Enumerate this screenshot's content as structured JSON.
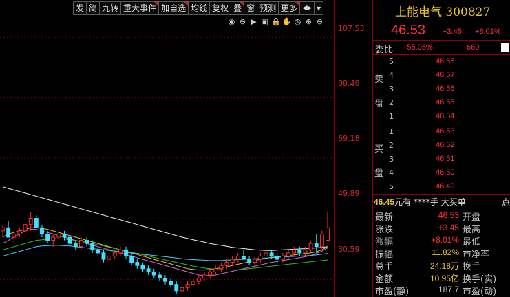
{
  "toolbar": {
    "buttons": [
      "发",
      "简",
      "九转",
      "重大事件",
      "加自选",
      "均线",
      "复权",
      "叠",
      "窗",
      "预测",
      "更多"
    ],
    "nav": "◀▶"
  },
  "tools": [
    "eye-icon",
    "zoom-out-icon",
    "play-icon",
    "chart-toggle-icon",
    "lock-icon",
    "hand-icon",
    "clock-icon",
    "plus-icon",
    "minus-icon"
  ],
  "price_axis": {
    "ticks": [
      "107.53",
      "88.48",
      "69.18",
      "49.89",
      "30.59"
    ]
  },
  "stock": {
    "name": "上能电气",
    "code": "300827",
    "price": "46.53",
    "change": "+3.45",
    "change_pct": "+8.01%"
  },
  "weibi": {
    "label": "委比",
    "value": "+55.05%",
    "diff": "660"
  },
  "sell": {
    "label_top": "卖",
    "label_bottom": "盘",
    "levels": [
      "5",
      "4",
      "3",
      "2",
      "1"
    ],
    "prices": [
      "46.58",
      "46.57",
      "46.56",
      "46.55",
      "46.54"
    ]
  },
  "buy": {
    "label_top": "买",
    "label_bottom": "盘",
    "levels": [
      "1",
      "2",
      "3",
      "4",
      "5"
    ],
    "prices": [
      "46.53",
      "46.52",
      "46.51",
      "46.50",
      "46.49"
    ]
  },
  "trade": {
    "price": "46.45",
    "unit": "元有",
    "vol": "****手",
    "type": "大买单",
    "extra": "点"
  },
  "stats": [
    {
      "l": "最新",
      "v": "46.53",
      "r": "开盘",
      "color": "#ff3030"
    },
    {
      "l": "涨跌",
      "v": "+3.45",
      "r": "最高",
      "color": "#ff3030"
    },
    {
      "l": "涨幅",
      "v": "+8.01%",
      "r": "最低",
      "color": "#ff3030"
    },
    {
      "l": "振幅",
      "v": "11.82%",
      "r": "市净率",
      "color": "#e6c229"
    },
    {
      "l": "总手",
      "v": "24.18万",
      "r": "换手",
      "color": "#e6c229"
    },
    {
      "l": "金额",
      "v": "10.95亿",
      "r": "换手(实)",
      "color": "#e6c229"
    },
    {
      "l": "市盈(静)",
      "v": "187.7",
      "r": "市盈(动)",
      "color": "#c0c0c0"
    }
  ],
  "chart_data": {
    "type": "candlestick",
    "ylim": [
      25,
      115
    ],
    "candles": [
      [
        46,
        48,
        44,
        47
      ],
      [
        47,
        49,
        45,
        44
      ],
      [
        44,
        46,
        42,
        45
      ],
      [
        45,
        47,
        44,
        46
      ],
      [
        46,
        49,
        45,
        48
      ],
      [
        48,
        52,
        46,
        50
      ],
      [
        50,
        51,
        47,
        47
      ],
      [
        47,
        48,
        44,
        45
      ],
      [
        45,
        46,
        42,
        43
      ],
      [
        43,
        45,
        41,
        44
      ],
      [
        44,
        46,
        43,
        45
      ],
      [
        45,
        46,
        43,
        44
      ],
      [
        44,
        45,
        41,
        42
      ],
      [
        42,
        43,
        40,
        41
      ],
      [
        41,
        44,
        40,
        43
      ],
      [
        43,
        44,
        41,
        42
      ],
      [
        42,
        43,
        39,
        40
      ],
      [
        40,
        41,
        38,
        39
      ],
      [
        39,
        40,
        36,
        37
      ],
      [
        37,
        39,
        36,
        38
      ],
      [
        38,
        40,
        37,
        39
      ],
      [
        39,
        41,
        38,
        40
      ],
      [
        40,
        41,
        37,
        38
      ],
      [
        38,
        39,
        35,
        36
      ],
      [
        36,
        37,
        34,
        35
      ],
      [
        35,
        36,
        33,
        34
      ],
      [
        34,
        35,
        32,
        33
      ],
      [
        33,
        34,
        31,
        32
      ],
      [
        32,
        33,
        30,
        31
      ],
      [
        31,
        32,
        29,
        30
      ],
      [
        30,
        31,
        28,
        29
      ],
      [
        29,
        30,
        26,
        27
      ],
      [
        27,
        29,
        26,
        28
      ],
      [
        28,
        30,
        27,
        29
      ],
      [
        29,
        31,
        28,
        30
      ],
      [
        30,
        32,
        29,
        31
      ],
      [
        31,
        33,
        30,
        32
      ],
      [
        32,
        34,
        31,
        33
      ],
      [
        33,
        35,
        32,
        34
      ],
      [
        34,
        36,
        33,
        35
      ],
      [
        35,
        37,
        34,
        36
      ],
      [
        36,
        38,
        35,
        37
      ],
      [
        37,
        39,
        36,
        38
      ],
      [
        38,
        40,
        37,
        37
      ],
      [
        37,
        38,
        35,
        36
      ],
      [
        36,
        38,
        35,
        37
      ],
      [
        37,
        39,
        36,
        38
      ],
      [
        38,
        40,
        37,
        39
      ],
      [
        39,
        40,
        37,
        38
      ],
      [
        38,
        39,
        36,
        37
      ],
      [
        37,
        39,
        36,
        38
      ],
      [
        38,
        40,
        37,
        39
      ],
      [
        39,
        41,
        38,
        40
      ],
      [
        40,
        41,
        38,
        39
      ],
      [
        39,
        41,
        38,
        40
      ],
      [
        40,
        43,
        39,
        42
      ],
      [
        42,
        45,
        39,
        41
      ],
      [
        41,
        46,
        40,
        45
      ],
      [
        43,
        52,
        43,
        47
      ]
    ],
    "ma": [
      {
        "color": "#f0f0f0",
        "values": [
          60,
          59.5,
          59,
          58.5,
          58,
          57.5,
          57,
          56.5,
          56,
          55.5,
          55,
          54.5,
          54,
          53.5,
          53,
          52.5,
          52,
          51.5,
          51,
          50.5,
          50,
          49.5,
          49,
          48.5,
          48,
          47.5,
          47,
          46.5,
          46,
          45.5,
          45,
          44.5,
          44,
          43.6,
          43.2,
          42.8,
          42.4,
          42,
          41.7,
          41.4,
          41.1,
          40.8,
          40.6,
          40.4,
          40.2,
          40,
          39.9,
          39.8,
          39.8,
          39.9,
          40,
          40.1,
          40.2,
          40.3,
          40.4,
          40.5,
          40.6,
          40.8,
          41
        ]
      },
      {
        "color": "#e6c229",
        "values": [
          44,
          45,
          45.5,
          46,
          46.5,
          47,
          47,
          46.8,
          46.5,
          46,
          45.5,
          45,
          44.5,
          44,
          43.5,
          43,
          42.5,
          42,
          41.5,
          41,
          40.5,
          40,
          39.5,
          39,
          38.5,
          38,
          37.5,
          37,
          36.5,
          36,
          35.5,
          35,
          34.5,
          34,
          33.8,
          33.6,
          33.6,
          33.8,
          34,
          34.3,
          34.6,
          35,
          35.4,
          35.8,
          36.2,
          36.6,
          37,
          37.3,
          37.6,
          37.8,
          38,
          38.2,
          38.4,
          38.6,
          38.8,
          39,
          39.4,
          40,
          41
        ]
      },
      {
        "color": "#e060e0",
        "values": [
          42,
          43,
          44,
          45,
          46,
          46.5,
          46.5,
          46,
          45.5,
          45,
          44.5,
          44,
          43.5,
          43,
          42.5,
          42,
          41.5,
          41,
          40.5,
          40,
          39.5,
          39,
          38.5,
          38,
          37.5,
          37,
          36.5,
          36,
          35.5,
          35,
          34.5,
          34,
          33.5,
          33,
          32.5,
          32,
          31.8,
          31.8,
          32,
          32.4,
          32.8,
          33.2,
          33.6,
          34,
          34.4,
          34.8,
          35.2,
          35.6,
          36,
          36.3,
          36.6,
          36.9,
          37.2,
          37.5,
          37.8,
          38.2,
          38.8,
          39.6,
          40.6
        ]
      },
      {
        "color": "#20c020",
        "values": [
          40,
          40.5,
          41,
          41.5,
          42,
          42.5,
          43,
          43.2,
          43.4,
          43.5,
          43.5,
          43.4,
          43.2,
          43,
          42.7,
          42.4,
          42,
          41.6,
          41.2,
          40.8,
          40.4,
          40,
          39.6,
          39.2,
          38.8,
          38.4,
          38,
          37.6,
          37.2,
          36.8,
          36.4,
          36,
          35.6,
          35.2,
          34.8,
          34.5,
          34.2,
          34,
          33.8,
          33.7,
          33.6,
          33.6,
          33.7,
          33.8,
          34,
          34.2,
          34.4,
          34.6,
          34.8,
          35,
          35.2,
          35.4,
          35.6,
          35.8,
          36,
          36.2,
          36.4,
          36.6,
          36.8
        ]
      },
      {
        "color": "#40c8ff",
        "values": [
          38,
          38.5,
          39,
          39.5,
          40,
          40.5,
          41,
          41.2,
          41.3,
          41.4,
          41.4,
          41.3,
          41.2,
          41,
          40.8,
          40.6,
          40.4,
          40.2,
          40,
          39.8,
          39.6,
          39.4,
          39.2,
          39,
          38.8,
          38.6,
          38.4,
          38.2,
          38,
          37.8,
          37.6,
          37.4,
          37.2,
          37,
          36.9,
          36.8,
          36.7,
          36.6,
          36.6,
          36.6,
          36.7,
          36.8,
          36.9,
          37,
          37.1,
          37.2,
          37.3,
          37.4,
          37.5,
          37.6,
          37.7,
          37.8,
          37.9,
          38,
          38.1,
          38.2,
          38.4,
          38.6,
          38.8
        ]
      }
    ]
  }
}
